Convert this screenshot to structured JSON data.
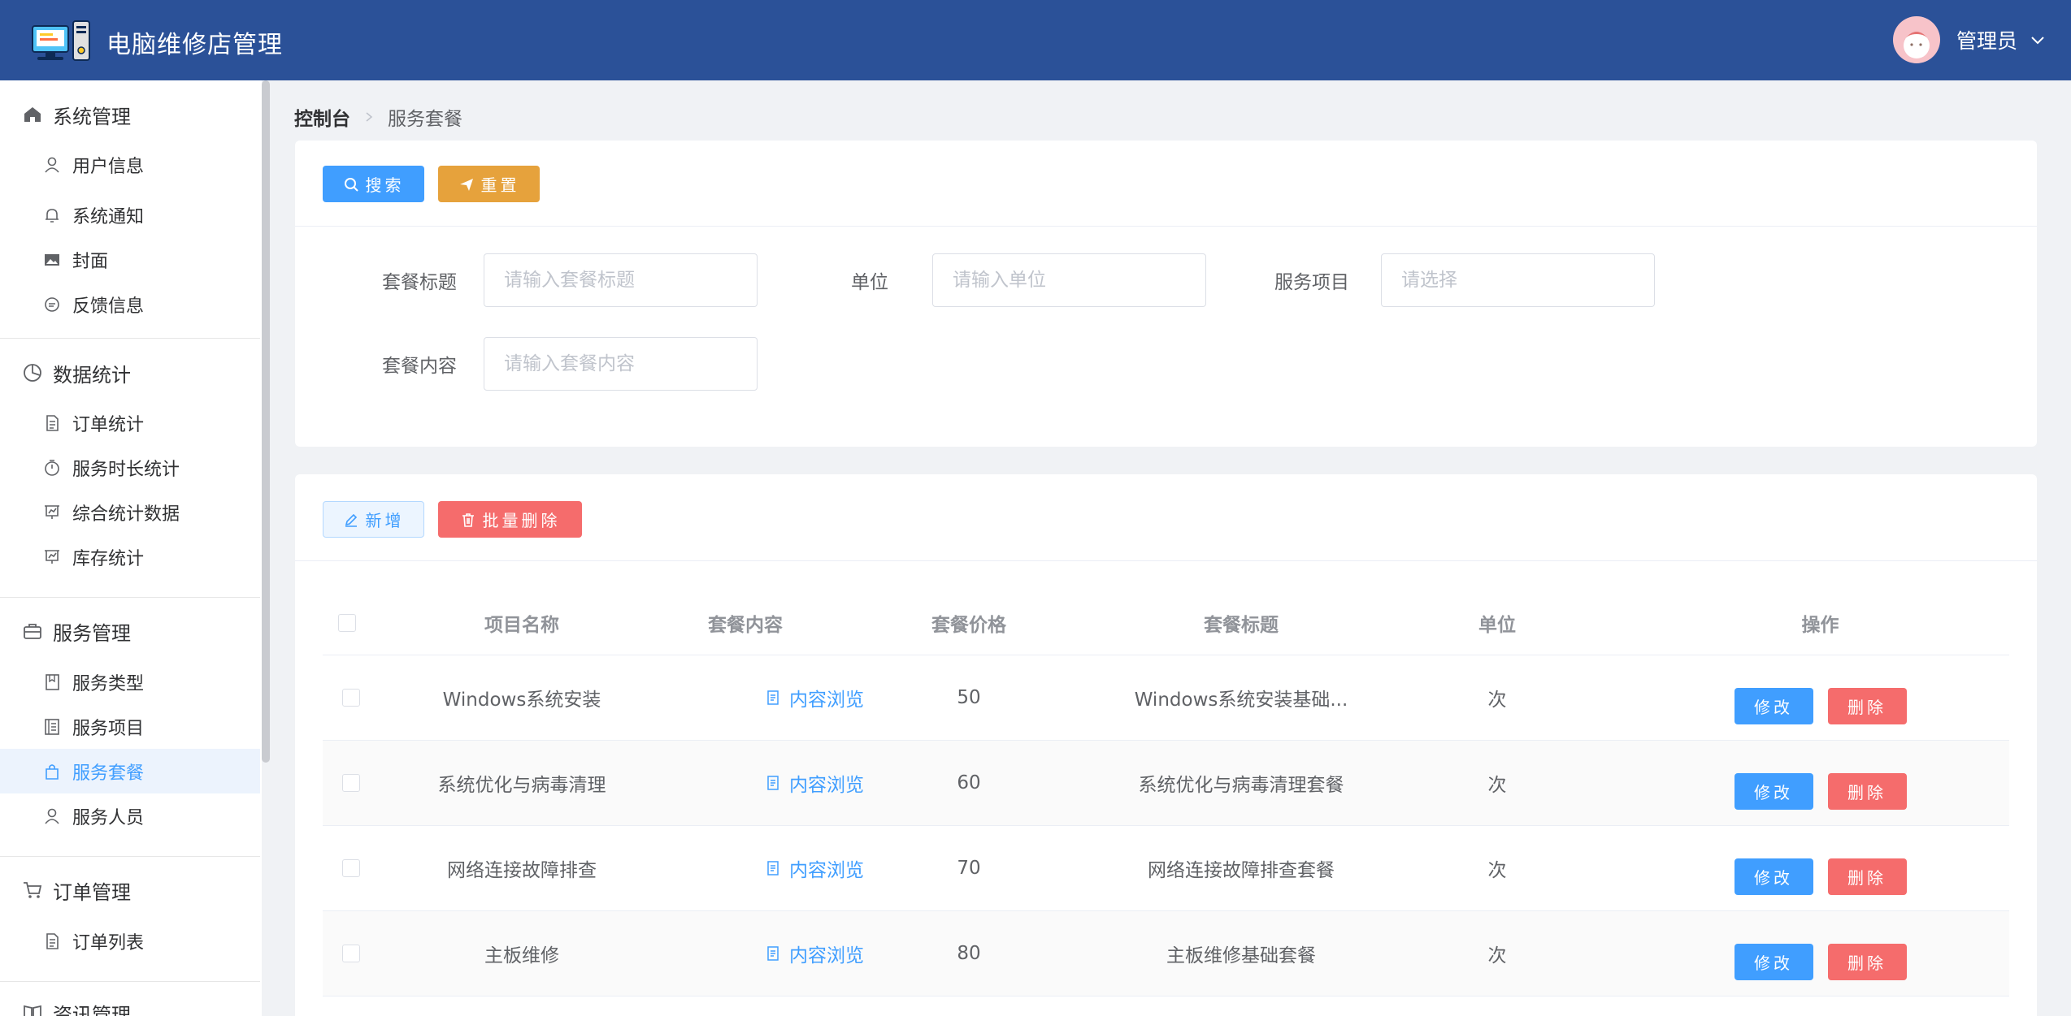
{
  "header": {
    "title": "电脑维修店管理",
    "user_name": "管理员"
  },
  "sidebar": {
    "groups": [
      {
        "label": "系统管理",
        "items": [
          {
            "label": "用户信息"
          },
          {
            "label": "系统通知"
          },
          {
            "label": "封面"
          },
          {
            "label": "反馈信息"
          }
        ]
      },
      {
        "label": "数据统计",
        "items": [
          {
            "label": "订单统计"
          },
          {
            "label": "服务时长统计"
          },
          {
            "label": "综合统计数据"
          },
          {
            "label": "库存统计"
          }
        ]
      },
      {
        "label": "服务管理",
        "items": [
          {
            "label": "服务类型"
          },
          {
            "label": "服务项目"
          },
          {
            "label": "服务套餐"
          },
          {
            "label": "服务人员"
          }
        ]
      },
      {
        "label": "订单管理",
        "items": [
          {
            "label": "订单列表"
          }
        ]
      },
      {
        "label": "资讯管理",
        "items": []
      }
    ],
    "active_item": "服务套餐"
  },
  "breadcrumb": {
    "root": "控制台",
    "current": "服务套餐"
  },
  "search_card": {
    "search_label": "搜索",
    "reset_label": "重置",
    "fields": [
      {
        "label": "套餐标题",
        "placeholder": "请输入套餐标题"
      },
      {
        "label": "单位",
        "placeholder": "请输入单位"
      },
      {
        "label": "服务项目",
        "placeholder": "请选择"
      },
      {
        "label": "套餐内容",
        "placeholder": "请输入套餐内容"
      }
    ]
  },
  "table_card": {
    "add_label": "新增",
    "batch_delete_label": "批量删除",
    "columns": [
      "项目名称",
      "套餐内容",
      "套餐价格",
      "套餐标题",
      "单位",
      "操作"
    ],
    "rows": [
      {
        "name": "Windows系统安装",
        "content": "内容浏览",
        "price": "50",
        "title": "Windows系统安装基础...",
        "unit": "次"
      },
      {
        "name": "系统优化与病毒清理",
        "content": "内容浏览",
        "price": "60",
        "title": "系统优化与病毒清理套餐",
        "unit": "次"
      },
      {
        "name": "网络连接故障排查",
        "content": "内容浏览",
        "price": "70",
        "title": "网络连接故障排查套餐",
        "unit": "次"
      },
      {
        "name": "主板维修",
        "content": "内容浏览",
        "price": "80",
        "title": "主板维修基础套餐",
        "unit": "次"
      }
    ],
    "edit_label": "修改",
    "delete_label": "删除"
  },
  "colors": {
    "header_bg": "#2b5198",
    "primary": "#409eff",
    "warning": "#e6a23c",
    "danger": "#f56c6c",
    "active_bg": "#ecf3fd"
  },
  "icons": {
    "logo": "computer-repair-logo-icon",
    "search": "search-icon",
    "reset": "send-icon",
    "add": "edit-icon",
    "batch_delete": "trash-icon",
    "content": "document-icon"
  }
}
